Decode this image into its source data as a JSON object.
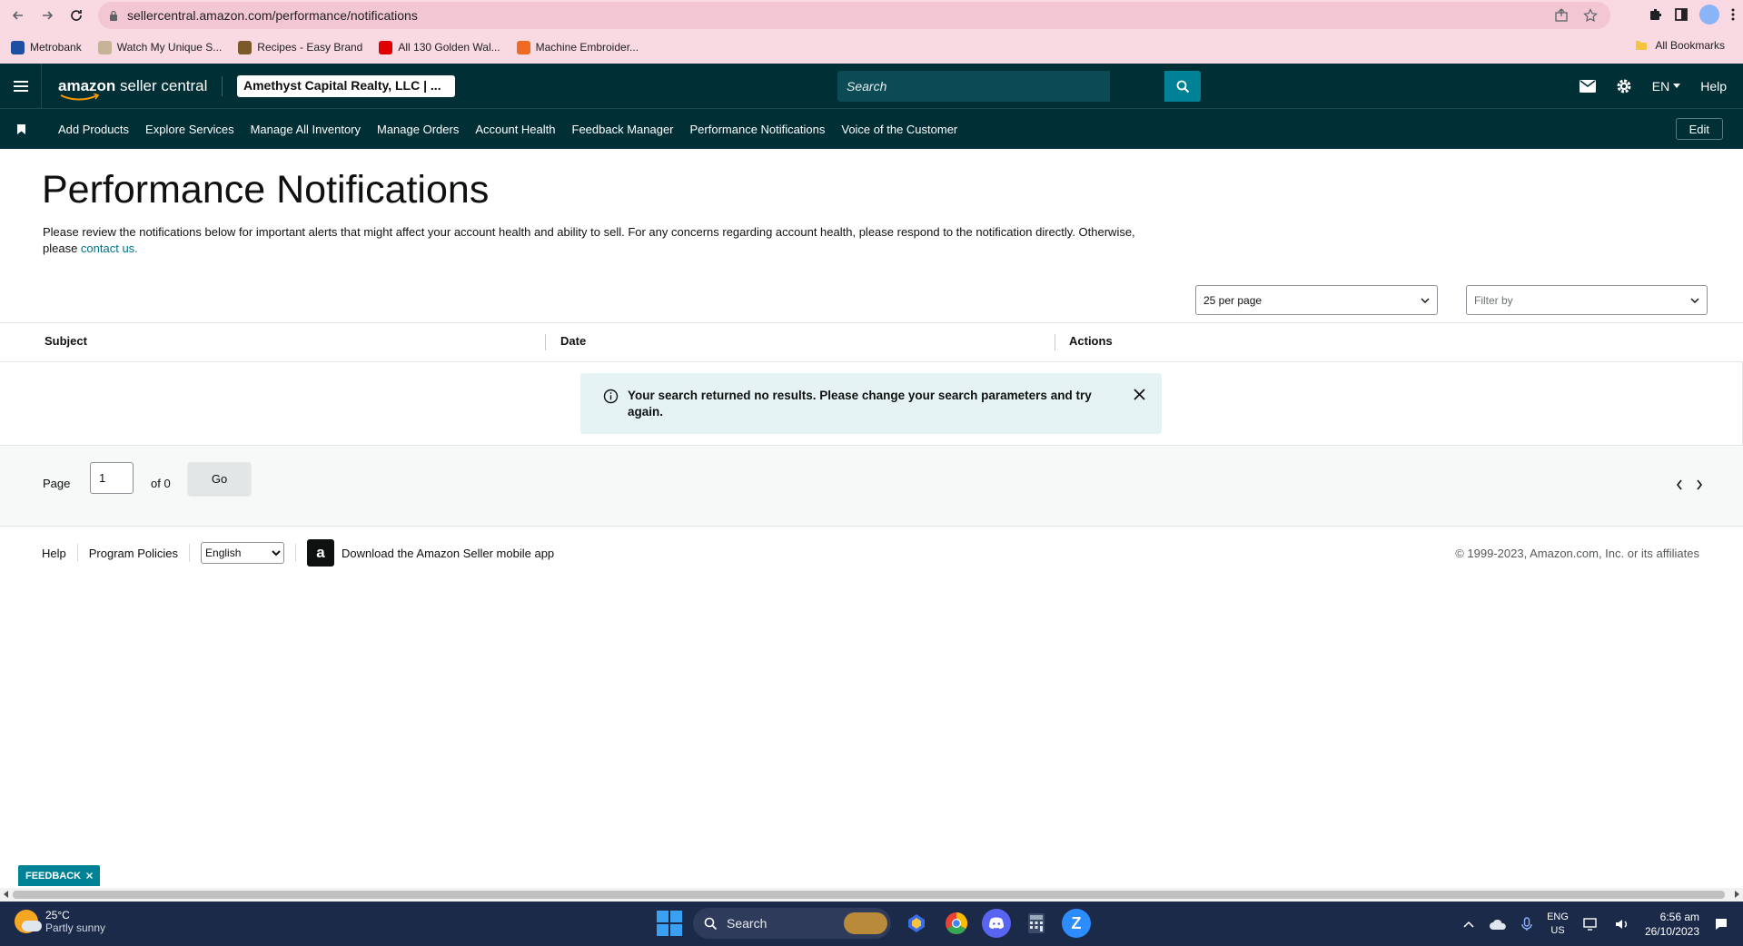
{
  "browser": {
    "url": "sellercentral.amazon.com/performance/notifications",
    "bookmarks": [
      {
        "label": "Metrobank",
        "color": "#1f4fa0"
      },
      {
        "label": "Watch My Unique S...",
        "color": "#c7b39a"
      },
      {
        "label": "Recipes - Easy Brand",
        "color": "#7a5a2a"
      },
      {
        "label": "All 130 Golden Wal...",
        "color": "#e00000"
      },
      {
        "label": "Machine Embroider...",
        "color": "#f06a22"
      }
    ],
    "all_bookmarks": "All Bookmarks"
  },
  "header": {
    "logo_amazon": "amazon",
    "logo_seller": " seller central",
    "merchant": "Amethyst Capital Realty, LLC | ...",
    "search_placeholder": "Search",
    "language": "EN",
    "help": "Help"
  },
  "nav": {
    "items": [
      "Add Products",
      "Explore Services",
      "Manage All Inventory",
      "Manage Orders",
      "Account Health",
      "Feedback Manager",
      "Performance Notifications",
      "Voice of the Customer"
    ],
    "edit": "Edit"
  },
  "main": {
    "title": "Performance Notifications",
    "intro": "Please review the notifications below for important alerts that might affect your account health and ability to sell. For any concerns regarding account health, please respond to the notification directly. Otherwise, please ",
    "contact_link": "contact us.",
    "per_page": "25 per page",
    "filter_placeholder": "Filter by",
    "columns": [
      "Subject",
      "Date",
      "Actions"
    ],
    "alert_message": "Your search returned no results. Please change your search parameters and try again."
  },
  "pagination": {
    "page_label": "Page",
    "current_page": "1",
    "of_label": "of 0",
    "go": "Go"
  },
  "footer": {
    "help": "Help",
    "program_policies": "Program Policies",
    "language_selected": "English",
    "app_download": "Download the Amazon Seller mobile app",
    "copyright": "© 1999-2023, Amazon.com, Inc. or its affiliates"
  },
  "feedback": {
    "label": "FEEDBACK"
  },
  "taskbar": {
    "temp": "25°C",
    "weather": "Partly sunny",
    "search": "Search",
    "lang_line1": "ENG",
    "lang_line2": "US",
    "time": "6:56 am",
    "date": "26/10/2023"
  },
  "colors": {
    "header_bg": "#002f36",
    "accent": "#008296",
    "link": "#007185",
    "alert_bg": "#e6f3f4"
  }
}
